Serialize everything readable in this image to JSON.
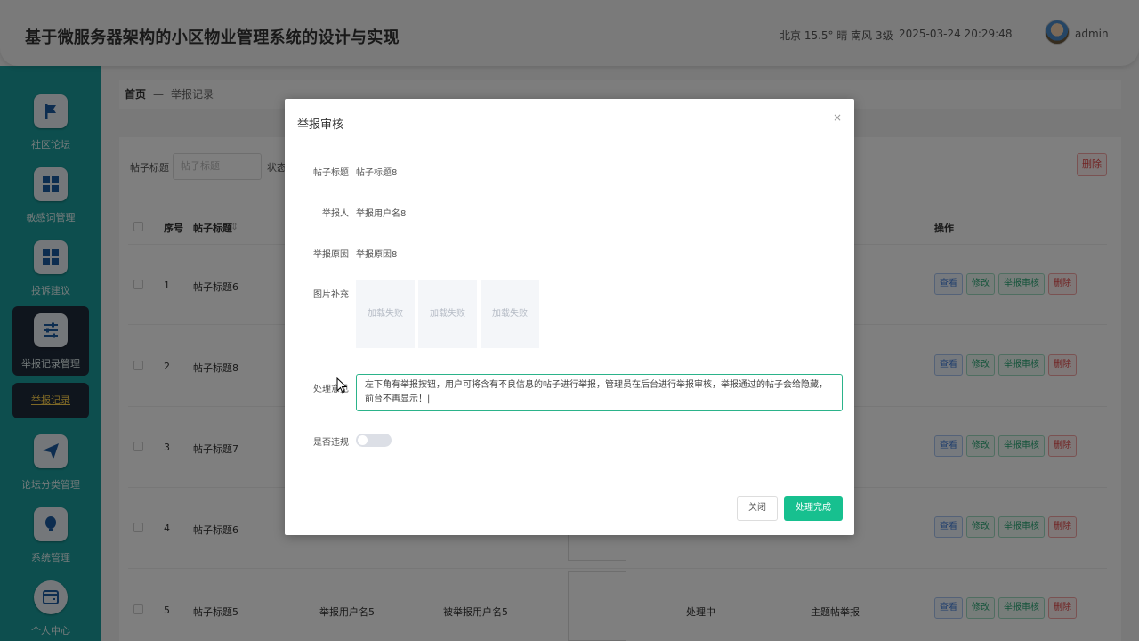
{
  "header": {
    "title": "基于微服务器架构的小区物业管理系统的设计与实现",
    "weather": "北京 15.5° 晴 南风 3级",
    "datetime": "2025-03-24 20:29:48",
    "username": "admin"
  },
  "sidebar": {
    "items": [
      {
        "label": "社区论坛",
        "icon": "flag-icon"
      },
      {
        "label": "敏感词管理",
        "icon": "grid-icon"
      },
      {
        "label": "投诉建议",
        "icon": "grid-icon"
      },
      {
        "label": "举报记录管理",
        "icon": "sliders-icon"
      },
      {
        "label": "论坛分类管理",
        "icon": "send-icon"
      },
      {
        "label": "系统管理",
        "icon": "bulb-icon"
      },
      {
        "label": "个人中心",
        "icon": "window-icon"
      }
    ],
    "sub_item": "举报记录"
  },
  "breadcrumb": {
    "home": "首页",
    "separator": "—",
    "current": "举报记录"
  },
  "filter": {
    "title_label": "帖子标题",
    "title_placeholder": "帖子标题",
    "status_label": "状态"
  },
  "toolbar": {
    "delete_label": "删除"
  },
  "table": {
    "headers": {
      "index": "序号",
      "title": "帖子标题",
      "sort": "⇕",
      "ops": "操作"
    },
    "op_labels": {
      "view": "查看",
      "edit": "修改",
      "audit": "举报审核",
      "delete": "删除"
    },
    "rows": [
      {
        "index": "1",
        "title": "帖子标题6"
      },
      {
        "index": "2",
        "title": "帖子标题8"
      },
      {
        "index": "3",
        "title": "帖子标题7"
      },
      {
        "index": "4",
        "title": "帖子标题6"
      },
      {
        "index": "5",
        "title": "帖子标题5",
        "reporter": "举报用户名5",
        "reported": "被举报用户名5",
        "status": "处理中",
        "type": "主题帖举报"
      }
    ]
  },
  "dialog": {
    "title": "举报审核",
    "close_icon": "×",
    "fields": {
      "post_title_label": "帖子标题",
      "post_title_value": "帖子标题8",
      "reporter_label": "举报人",
      "reporter_value": "举报用户名8",
      "reason_label": "举报原因",
      "reason_value": "举报原因8",
      "images_label": "图片补充",
      "image_failed": "加载失败",
      "opinion_label": "处理意见",
      "opinion_value": "左下角有举报按钮，用户可将含有不良信息的帖子进行举报，管理员在后台进行举报审核，举报通过的帖子会给隐藏，前台不再显示！|",
      "violation_label": "是否违规",
      "violation_on": false
    },
    "close_button": "关闭",
    "done_button": "处理完成"
  },
  "colors": {
    "sidebar": "#1a9c9c",
    "active": "#1f2a3a",
    "primary": "#17c08f",
    "danger": "#e04545"
  }
}
